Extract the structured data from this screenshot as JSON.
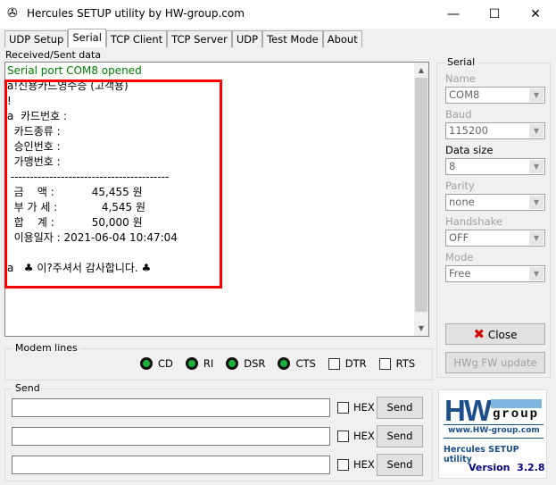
{
  "window": {
    "title": "Hercules SETUP utility by HW-group.com",
    "minimize": "—",
    "maximize": "☐",
    "close": "✕"
  },
  "tabs": [
    "UDP Setup",
    "Serial",
    "TCP Client",
    "TCP Server",
    "UDP",
    "Test Mode",
    "About"
  ],
  "received_label": "Received/Sent data",
  "received_lines": [
    {
      "text": "Serial port COM8 opened",
      "color": "#008000"
    },
    {
      "text": "a!신용카드영수증 (고객용)",
      "color": "#000000"
    },
    {
      "text": "!",
      "color": "#000000"
    },
    {
      "text": "a  카드번호 :",
      "color": "#000000"
    },
    {
      "text": "  카드종류 :",
      "color": "#000000"
    },
    {
      "text": "  승인번호 :",
      "color": "#000000"
    },
    {
      "text": "  가맹번호 :",
      "color": "#000000"
    },
    {
      "text": " -----------------------------------------",
      "color": "#000000"
    },
    {
      "text": "  금    액 :           45,455 원",
      "color": "#000000"
    },
    {
      "text": "  부 가 세 :             4,545 원",
      "color": "#000000"
    },
    {
      "text": "  합    계 :           50,000 원",
      "color": "#000000"
    },
    {
      "text": "  이용일자 : 2021-06-04 10:47:04",
      "color": "#000000"
    },
    {
      "text": "",
      "color": "#000000"
    },
    {
      "text": "a   ♣ 이?주셔서 감사합니다. ♣",
      "color": "#000000"
    }
  ],
  "modem": {
    "label": "Modem lines",
    "leds": [
      "CD",
      "RI",
      "DSR",
      "CTS"
    ],
    "checks": [
      "DTR",
      "RTS"
    ]
  },
  "send": {
    "label": "Send",
    "rows": [
      {
        "value": "",
        "hex": "HEX",
        "button": "Send"
      },
      {
        "value": "",
        "hex": "HEX",
        "button": "Send"
      },
      {
        "value": "",
        "hex": "HEX",
        "button": "Send"
      }
    ]
  },
  "serial": {
    "label": "Serial",
    "fields": [
      {
        "label": "Name",
        "value": "COM8",
        "enabled": false
      },
      {
        "label": "Baud",
        "value": "115200",
        "enabled": false
      },
      {
        "label": "Data size",
        "value": "8",
        "enabled": true
      },
      {
        "label": "Parity",
        "value": "none",
        "enabled": false
      },
      {
        "label": "Handshake",
        "value": "OFF",
        "enabled": false
      },
      {
        "label": "Mode",
        "value": "Free",
        "enabled": false
      }
    ],
    "close_button": "Close",
    "fw_button": "HWg FW update"
  },
  "logo": {
    "hw": "HW",
    "group": "group",
    "url": "www.HW-group.com",
    "product": "Hercules SETUP utility",
    "version": "Version  3.2.8"
  }
}
